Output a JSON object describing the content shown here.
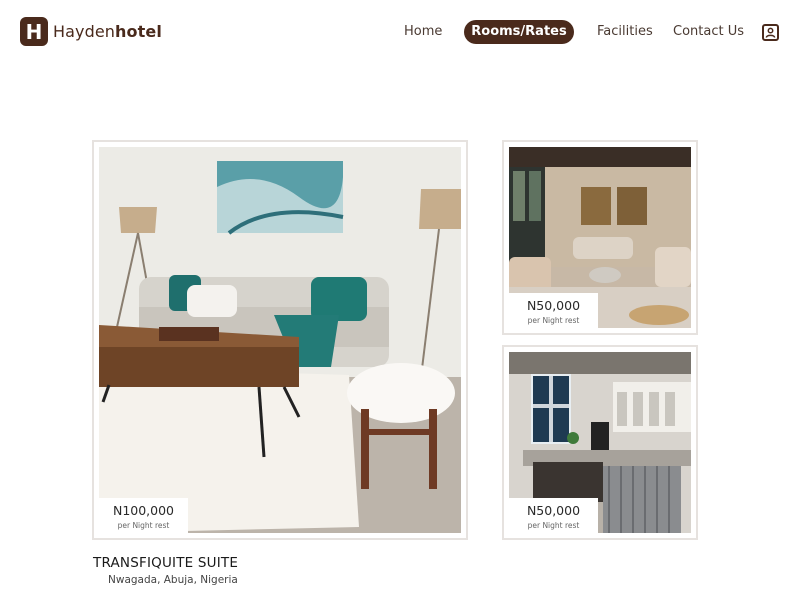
{
  "brand": {
    "logo_letter": "H",
    "name_light": "Hayden",
    "name_bold": "hotel"
  },
  "nav": {
    "items": [
      {
        "label": "Home"
      },
      {
        "label": "Rooms/Rates",
        "active": true
      },
      {
        "label": "Facilities"
      },
      {
        "label": "Contact Us"
      }
    ],
    "profile_icon": "user-profile-icon"
  },
  "rooms": [
    {
      "price": "N100,000",
      "per": "per Night rest",
      "photo": "living-room-photo"
    },
    {
      "price": "N50,000",
      "per": "per Night rest",
      "photo": "lounge-photo"
    },
    {
      "price": "N50,000",
      "per": "per Night rest",
      "photo": "kitchen-photo"
    }
  ],
  "featured": {
    "title": "TRANSFIQUITE SUITE",
    "location": "Nwagada, Abuja, Nigeria"
  },
  "colors": {
    "brand": "#4a2a1c",
    "card_border": "#e6e2df"
  }
}
